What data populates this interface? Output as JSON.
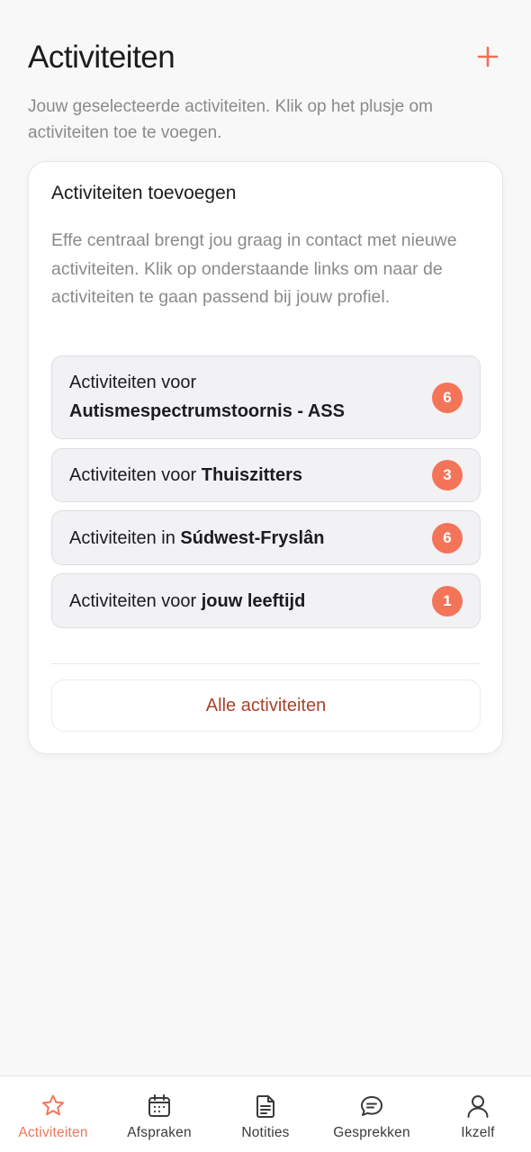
{
  "header": {
    "title": "Activiteiten",
    "add_icon": "plus-icon"
  },
  "subtitle": "Jouw geselecteerde activiteiten. Klik op het plusje om activiteiten toe te voegen.",
  "card": {
    "title": "Activiteiten toevoegen",
    "description": "Effe centraal brengt jou graag in contact met nieuwe activiteiten. Klik op onderstaande links om naar de activiteiten te gaan passend bij jouw profiel.",
    "links": [
      {
        "prefix": "Activiteiten voor",
        "bold": "Autismespectrumstoornis - ASS",
        "count": "6"
      },
      {
        "prefix": "Activiteiten voor",
        "bold": "Thuiszitters",
        "count": "3"
      },
      {
        "prefix": "Activiteiten in",
        "bold": "Súdwest-Fryslân",
        "count": "6"
      },
      {
        "prefix": "Activiteiten voor",
        "bold": "jouw leeftijd",
        "count": "1"
      }
    ],
    "all_button": "Alle activiteiten"
  },
  "tabbar": {
    "items": [
      {
        "label": "Activiteiten",
        "icon": "star-icon",
        "active": true
      },
      {
        "label": "Afspraken",
        "icon": "calendar-icon",
        "active": false
      },
      {
        "label": "Notities",
        "icon": "document-icon",
        "active": false
      },
      {
        "label": "Gesprekken",
        "icon": "chat-bubble-icon",
        "active": false
      },
      {
        "label": "Ikzelf",
        "icon": "person-icon",
        "active": false
      }
    ]
  },
  "colors": {
    "accent": "#f47459",
    "accent_text": "#a8432b",
    "background": "#f8f8f8"
  }
}
